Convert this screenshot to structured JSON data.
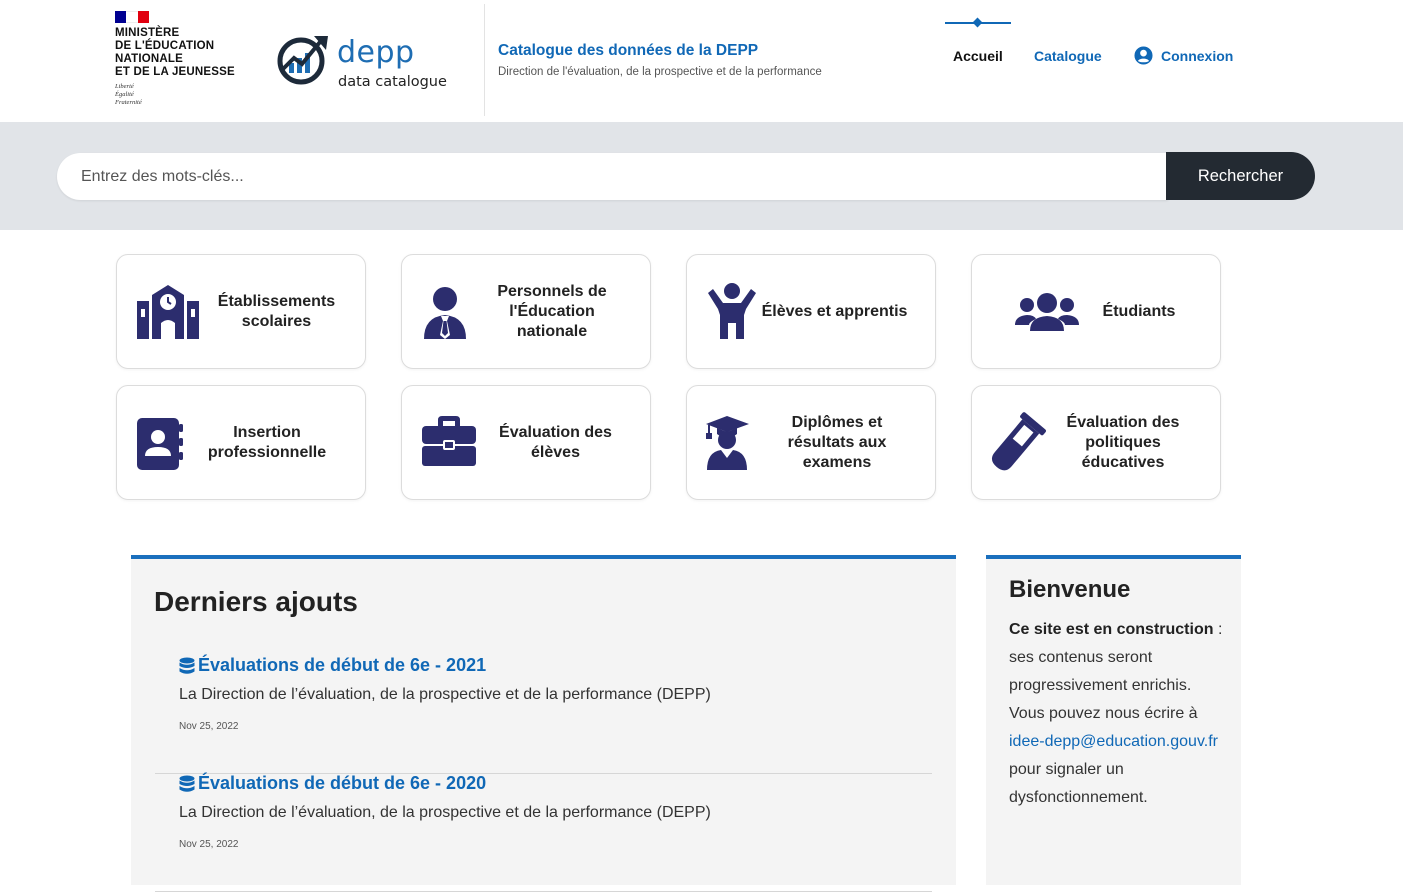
{
  "header": {
    "ministry_lines": [
      "MINISTÈRE",
      "DE L'ÉDUCATION",
      "NATIONALE",
      "ET DE LA JEUNESSE"
    ],
    "devise_lines": [
      "Liberté",
      "Égalité",
      "Fraternité"
    ],
    "logo_word": "depp",
    "logo_sub": "data catalogue",
    "site_title": "Catalogue des données de la DEPP",
    "site_subtitle": "Direction de l'évaluation, de la prospective et de la performance"
  },
  "nav": {
    "accueil": "Accueil",
    "catalogue": "Catalogue",
    "connexion": "Connexion"
  },
  "search": {
    "placeholder": "Entrez des mots-clés...",
    "button": "Rechercher"
  },
  "categories": [
    {
      "label": "Établissements scolaires",
      "icon": "school-icon"
    },
    {
      "label": "Personnels de l'Éducation nationale",
      "icon": "user-tie-icon"
    },
    {
      "label": "Élèves et apprentis",
      "icon": "child-icon"
    },
    {
      "label": "Étudiants",
      "icon": "users-icon"
    },
    {
      "label": "Insertion professionnelle",
      "icon": "address-book-icon"
    },
    {
      "label": "Évaluation des élèves",
      "icon": "briefcase-icon"
    },
    {
      "label": "Diplômes et résultats aux examens",
      "icon": "graduate-icon"
    },
    {
      "label": "Évaluation des politiques éducatives",
      "icon": "test-tube-icon"
    }
  ],
  "latest": {
    "title": "Derniers ajouts",
    "items": [
      {
        "title": "Évaluations de début de 6e - 2021",
        "desc": "La Direction de l’évaluation, de la prospective et de la performance (DEPP)",
        "date": "Nov 25, 2022"
      },
      {
        "title": "Évaluations de début de 6e - 2020",
        "desc": "La Direction de l’évaluation, de la prospective et de la performance (DEPP)",
        "date": "Nov 25, 2022"
      }
    ]
  },
  "welcome": {
    "title": "Bienvenue",
    "bold": "Ce site est en construction",
    "text1": " : ses contenus seront progressivement enrichis. Vous pouvez nous écrire à ",
    "email": "idee-depp@education.gouv.fr",
    "text2": " pour signaler un dysfonctionnement."
  },
  "colors": {
    "accent": "#1068b6",
    "icon": "#2c2d6e",
    "dark_button": "#232a32",
    "band": "#e1e4e8"
  }
}
